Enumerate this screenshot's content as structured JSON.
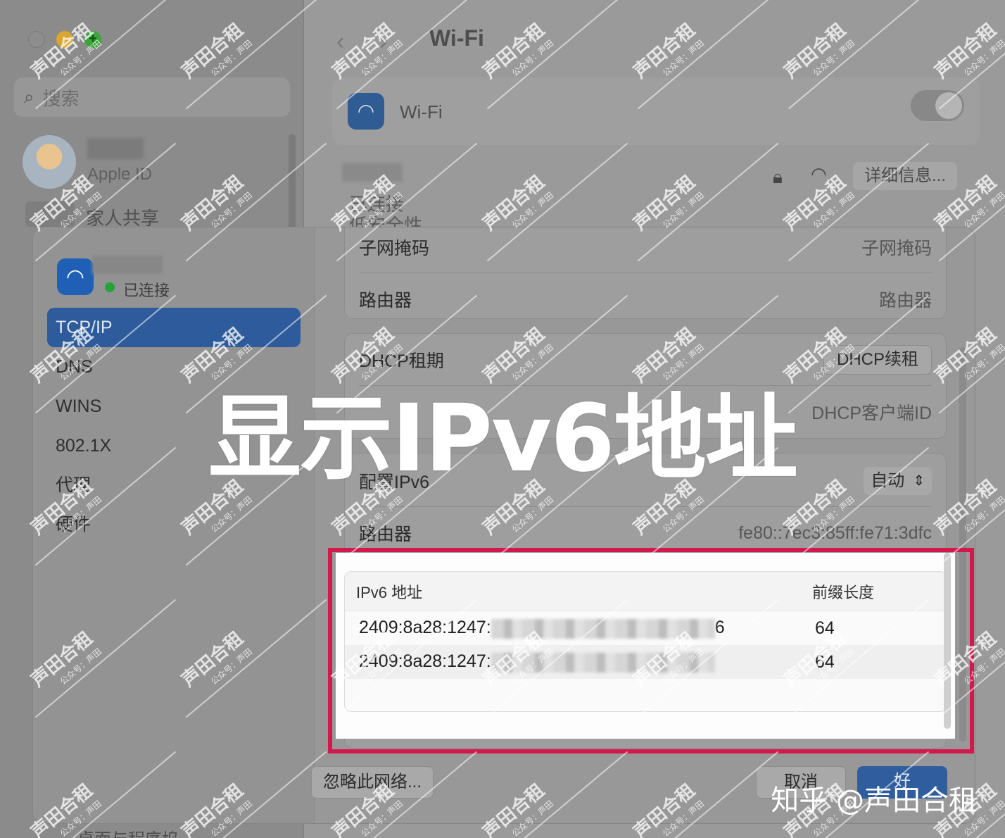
{
  "background_window": {
    "search_placeholder": "搜索",
    "account_label": "Apple ID",
    "family_label": "家人共享",
    "title": "Wi-Fi",
    "wifi_label": "Wi-Fi",
    "details_button": "详细信息...",
    "status_connected": "已连接",
    "status_security": "低安全性",
    "bottom_item": "桌面与程序坞"
  },
  "dialog": {
    "connection_status": "已连接",
    "sidebar_items": [
      "TCP/IP",
      "DNS",
      "WINS",
      "802.1X",
      "代理",
      "硬件"
    ],
    "active_item": "TCP/IP",
    "rows_group1": [
      {
        "label": "子网掩码",
        "value": "子网掩码"
      },
      {
        "label": "路由器",
        "value": "路由器"
      }
    ],
    "dhcp_lease_label": "DHCP租期",
    "dhcp_renew_button": "DHCP续租",
    "dhcp_client_value": "DHCP客户端ID",
    "configure_ipv6_label": "配置IPv6",
    "configure_ipv6_value": "自动",
    "ipv6_router_label": "路由器",
    "ipv6_router_value": "fe80::7ec3:85ff:fe71:3dfc",
    "ipv6_table": {
      "headers": [
        "IPv6 地址",
        "前缀长度"
      ],
      "rows": [
        {
          "address_visible": "2409:8a28:1247:",
          "address_tail": "6",
          "prefix": "64"
        },
        {
          "address_visible": "2409:8a28:1247:",
          "prefix": "64"
        }
      ]
    },
    "ignore_button": "忽略此网络...",
    "cancel_button": "取消",
    "ok_button": "好"
  },
  "overlay": {
    "headline": "显示IPv6地址",
    "credit": "知乎 @声田合租",
    "watermark": "声田合租",
    "watermark_sub": "公众号：声田"
  },
  "colors": {
    "highlight": "#d2184c",
    "selected": "#2e5b9b",
    "connected_dot": "#24a33b"
  }
}
